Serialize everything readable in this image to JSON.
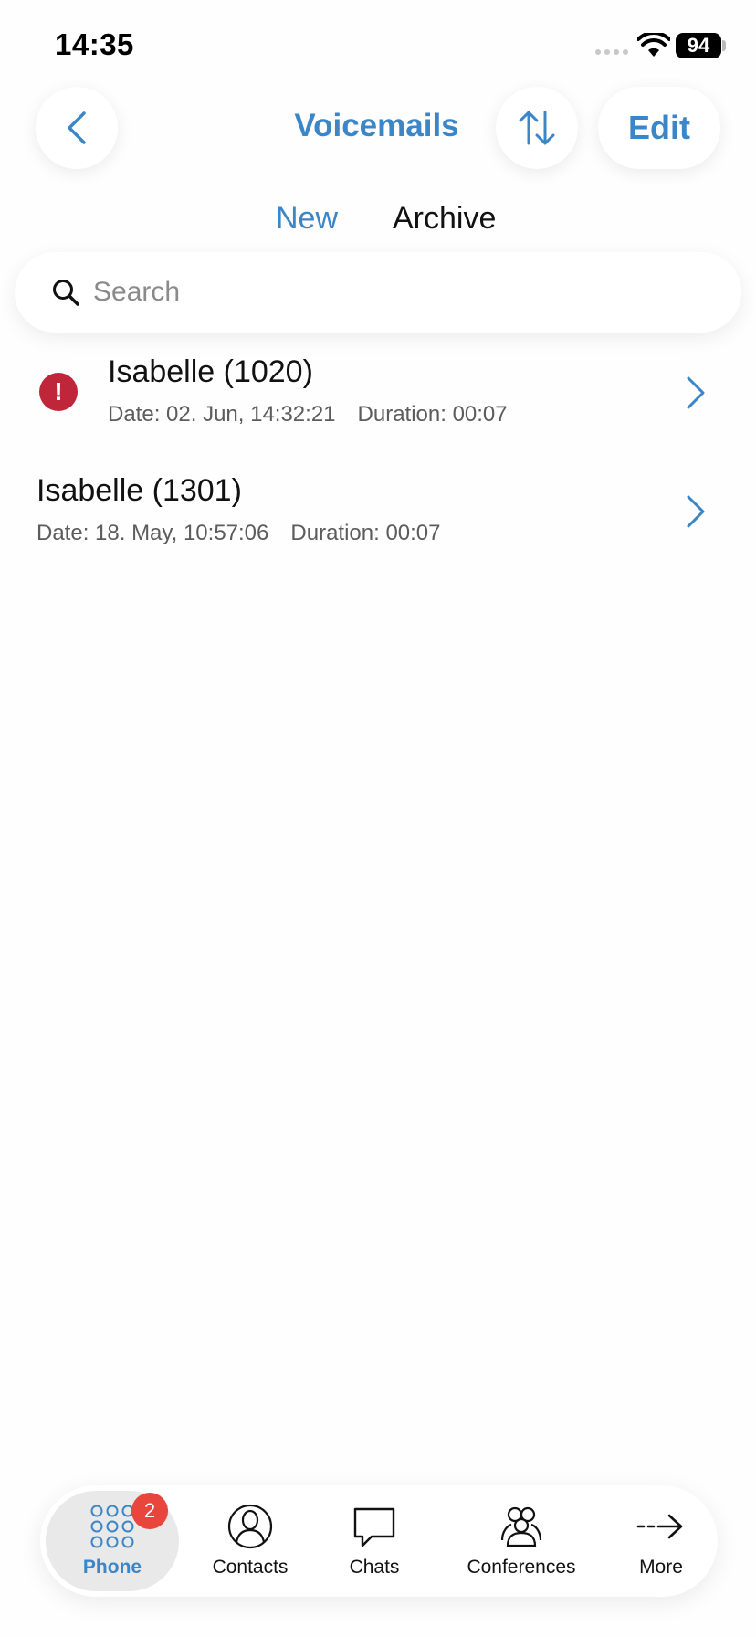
{
  "status_bar": {
    "time": "14:35",
    "battery": "94"
  },
  "header": {
    "title": "Voicemails",
    "edit_label": "Edit",
    "back_icon": "chevron-left-icon",
    "sort_icon": "sort-arrows-icon"
  },
  "tabs": [
    {
      "label": "New",
      "selected": true
    },
    {
      "label": "Archive",
      "selected": false
    }
  ],
  "search": {
    "placeholder": "Search",
    "value": ""
  },
  "voicemails": [
    {
      "name": "Isabelle (1020)",
      "date": "Date: 02. Jun, 14:32:21",
      "duration": "Duration: 00:07",
      "unheard": true
    },
    {
      "name": "Isabelle (1301)",
      "date": "Date: 18. May, 10:57:06",
      "duration": "Duration: 00:07",
      "unheard": false
    }
  ],
  "tabbar": {
    "items": [
      {
        "label": "Phone",
        "icon": "dialpad-icon",
        "badge": "2",
        "selected": true
      },
      {
        "label": "Contacts",
        "icon": "person-icon"
      },
      {
        "label": "Chats",
        "icon": "chat-bubble-icon"
      },
      {
        "label": "Conferences",
        "icon": "group-icon"
      },
      {
        "label": "More",
        "icon": "arrow-right-icon"
      }
    ]
  },
  "colors": {
    "accent": "#3a86c8",
    "alert": "#c0263a",
    "badge": "#e8453c"
  }
}
